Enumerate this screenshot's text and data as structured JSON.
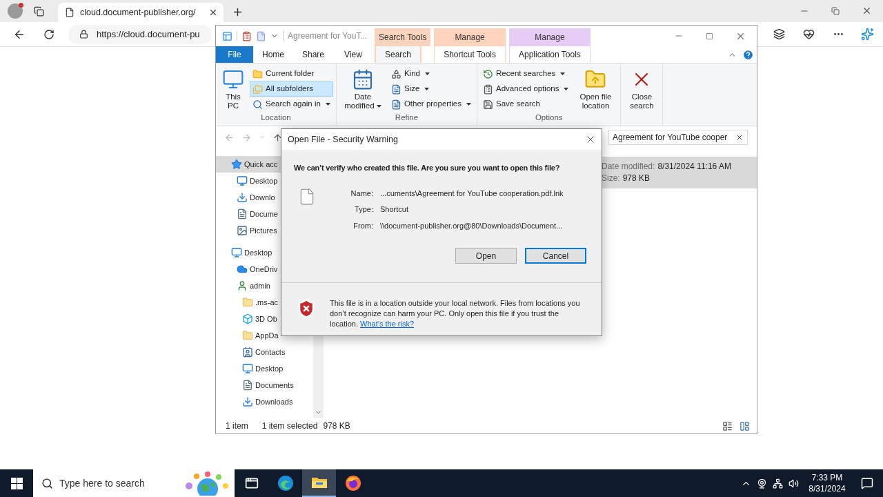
{
  "browser": {
    "tab_title": "cloud.document-publisher.org/",
    "address": "https://cloud.document-pu"
  },
  "explorer": {
    "title": "Agreement for YouT...",
    "tabs": [
      {
        "label": "File",
        "kind": "file",
        "selected": false
      },
      {
        "label": "Home",
        "kind": "tab",
        "selected": false
      },
      {
        "label": "Share",
        "kind": "tab",
        "selected": false
      },
      {
        "label": "View",
        "kind": "tab",
        "selected": false
      }
    ],
    "context_groups": [
      {
        "label": "Search Tools",
        "color": "#f9d3bb",
        "tabs": [
          {
            "label": "Search",
            "selected": true
          }
        ]
      },
      {
        "label": "Manage",
        "color": "#fdd3bd",
        "tabs": [
          {
            "label": "Shortcut Tools",
            "selected": false
          }
        ]
      },
      {
        "label": "Manage",
        "color": "#e7cdf5",
        "tabs": [
          {
            "label": "Application Tools",
            "selected": false
          }
        ]
      }
    ],
    "ribbon_groups": [
      {
        "label": "Location",
        "items": [
          {
            "label": "This PC",
            "kind": "large",
            "dropdown": false,
            "selected": false
          },
          {
            "label": "Current folder",
            "kind": "small",
            "dropdown": false,
            "selected": false
          },
          {
            "label": "All subfolders",
            "kind": "small",
            "dropdown": false,
            "selected": true
          },
          {
            "label": "Search again in",
            "kind": "small",
            "dropdown": true,
            "selected": false
          }
        ]
      },
      {
        "label": "Refine",
        "items": [
          {
            "label": "Date modified",
            "kind": "large",
            "dropdown": true,
            "selected": false
          },
          {
            "label": "Kind",
            "kind": "small",
            "dropdown": true,
            "selected": false
          },
          {
            "label": "Size",
            "kind": "small",
            "dropdown": true,
            "selected": false
          },
          {
            "label": "Other properties",
            "kind": "small",
            "dropdown": true,
            "selected": false
          }
        ]
      },
      {
        "label": "Options",
        "items": [
          {
            "label": "Recent searches",
            "kind": "small",
            "dropdown": true,
            "selected": false
          },
          {
            "label": "Advanced options",
            "kind": "small",
            "dropdown": true,
            "selected": false
          },
          {
            "label": "Save search",
            "kind": "small",
            "dropdown": false,
            "selected": false
          },
          {
            "label": "Open file location",
            "kind": "large",
            "dropdown": false,
            "selected": false
          }
        ]
      },
      {
        "items": [
          {
            "label": "Close search",
            "kind": "large",
            "dropdown": false,
            "selected": false
          }
        ]
      }
    ],
    "search": {
      "value": "Agreement for YouTube cooper"
    },
    "nav_tree": [
      {
        "label": "Quick acc",
        "kind": "star",
        "selected": true,
        "children": [
          {
            "label": "Desktop",
            "kind": "desktop",
            "selected": false
          },
          {
            "label": "Downlo",
            "kind": "download",
            "selected": false
          },
          {
            "label": "Docume",
            "kind": "document",
            "selected": false
          },
          {
            "label": "Pictures",
            "kind": "pictures",
            "selected": false
          }
        ]
      },
      {
        "label": "Desktop",
        "kind": "desktop",
        "selected": false,
        "children": [
          {
            "label": "OneDriv",
            "kind": "cloud",
            "selected": false
          },
          {
            "label": "admin",
            "kind": "user",
            "selected": false,
            "children": [
              {
                "label": ".ms-ac",
                "kind": "folder",
                "selected": false
              },
              {
                "label": "3D Ob",
                "kind": "cube",
                "selected": false
              },
              {
                "label": "AppDa",
                "kind": "folder",
                "selected": false
              },
              {
                "label": "Contacts",
                "kind": "contacts",
                "selected": false
              },
              {
                "label": "Desktop",
                "kind": "desktop",
                "selected": false
              },
              {
                "label": "Documents",
                "kind": "document",
                "selected": false
              },
              {
                "label": "Downloads",
                "kind": "download",
                "selected": false
              }
            ]
          }
        ]
      }
    ],
    "results": [
      {
        "selected": true,
        "fields": [
          {
            "label": "Date modified:",
            "value": "8/31/2024 11:16 AM"
          },
          {
            "label": "Size:",
            "value": "978 KB"
          }
        ]
      }
    ],
    "status": {
      "count": "1 item",
      "selection": "1 item selected",
      "size": "978 KB"
    }
  },
  "dialog": {
    "title": "Open File - Security Warning",
    "headline": "We can’t verify who created this file. Are you sure you want to open this file?",
    "fields": [
      {
        "label": "Name:",
        "value": "...cuments\\Agreement for YouTube cooperation.pdf.lnk"
      },
      {
        "label": "Type:",
        "value": "Shortcut"
      },
      {
        "label": "From:",
        "value": "\\\\document-publisher.org@80\\Downloads\\Document..."
      }
    ],
    "buttons": [
      {
        "label": "Open",
        "default": false
      },
      {
        "label": "Cancel",
        "default": true
      }
    ],
    "warning": {
      "text": "This file is in a location outside your local network. Files from locations you don’t recognize can harm your PC. Only open this file if you trust the location.",
      "link": "What’s the risk?"
    }
  },
  "taskbar": {
    "search_placeholder": "Type here to search",
    "apps": [
      {
        "kind": "taskview",
        "selected": false
      },
      {
        "kind": "edge",
        "selected": false
      },
      {
        "kind": "explorer",
        "selected": true
      },
      {
        "kind": "firefox",
        "selected": false
      }
    ],
    "time": "7:33 PM",
    "date": "8/31/2024"
  }
}
